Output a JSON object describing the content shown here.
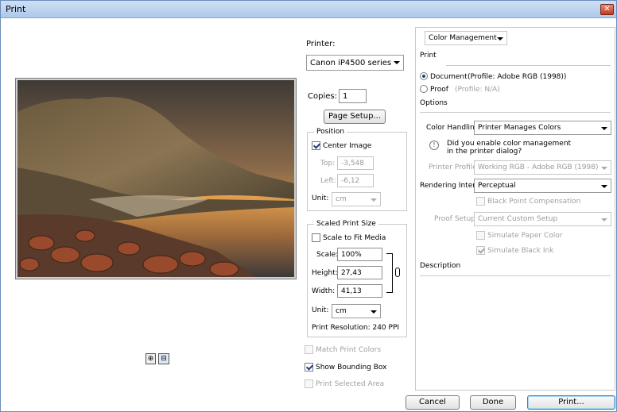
{
  "window": {
    "title": "Print",
    "close_glyph": "✕"
  },
  "printer": {
    "label": "Printer:",
    "selected": "Canon iP4500 series"
  },
  "copies": {
    "label": "Copies:",
    "value": "1"
  },
  "page_setup_label": "Page Setup...",
  "position": {
    "title": "Position",
    "center_image_label": "Center Image",
    "top_label": "Top:",
    "top_value": "-3,548",
    "left_label": "Left:",
    "left_value": "-6,12",
    "unit_label": "Unit:",
    "unit_value": "cm"
  },
  "scaled": {
    "title": "Scaled Print Size",
    "scale_to_fit_label": "Scale to Fit Media",
    "scale_label": "Scale:",
    "scale_value": "100%",
    "height_label": "Height:",
    "height_value": "27,43",
    "width_label": "Width:",
    "width_value": "41,13",
    "unit_label": "Unit:",
    "unit_value": "cm",
    "resolution": "Print Resolution: 240 PPI"
  },
  "options": {
    "match_print_colors": "Match Print Colors",
    "show_bounding_box": "Show Bounding Box",
    "print_selected_area": "Print Selected Area"
  },
  "right_panel": {
    "section_dropdown": "Color Management",
    "print_header": "Print",
    "document_label": "Document",
    "document_profile": "(Profile: Adobe RGB (1998))",
    "proof_label": "Proof",
    "proof_profile": "(Profile: N/A)",
    "options_header": "Options",
    "color_handling_label": "Color Handling:",
    "color_handling_value": "Printer Manages Colors",
    "warning_text_1": "Did you enable color management",
    "warning_text_2": "in the printer dialog?",
    "printer_profile_label": "Printer Profile:",
    "printer_profile_value": "Working RGB - Adobe RGB (1998)",
    "rendering_intent_label": "Rendering Intent:",
    "rendering_intent_value": "Perceptual",
    "black_point_label": "Black Point Compensation",
    "proof_setup_label": "Proof Setup:",
    "proof_setup_value": "Current Custom Setup",
    "simulate_paper_label": "Simulate Paper Color",
    "simulate_black_label": "Simulate Black Ink",
    "description_header": "Description"
  },
  "footer": {
    "cancel": "Cancel",
    "done": "Done",
    "print": "Print..."
  }
}
